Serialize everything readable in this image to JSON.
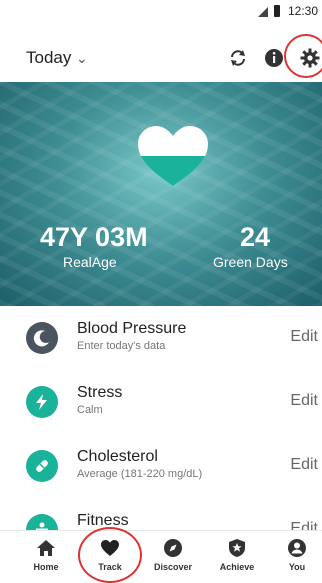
{
  "status": {
    "time": "12:30"
  },
  "header": {
    "title": "Today"
  },
  "hero": {
    "age_value": "47Y 03M",
    "age_label": "RealAge",
    "green_value": "24",
    "green_label": "Green Days"
  },
  "metrics": [
    {
      "name": "Blood Pressure",
      "subtitle": "Enter today's data",
      "action": "Edit",
      "icon": "moon-icon",
      "color": "#4a5560"
    },
    {
      "name": "Stress",
      "subtitle": "Calm",
      "action": "Edit",
      "icon": "lightning-icon",
      "color": "#1bb29a"
    },
    {
      "name": "Cholesterol",
      "subtitle": "Average (181-220 mg/dL)",
      "action": "Edit",
      "icon": "pill-icon",
      "color": "#1bb29a"
    },
    {
      "name": "Fitness",
      "subtitle": "",
      "action": "Edit",
      "icon": "person-icon",
      "color": "#1bb29a"
    }
  ],
  "tabs": [
    {
      "label": "Home",
      "icon": "home-icon"
    },
    {
      "label": "Track",
      "icon": "heart-icon"
    },
    {
      "label": "Discover",
      "icon": "compass-icon"
    },
    {
      "label": "Achieve",
      "icon": "shield-star-icon"
    },
    {
      "label": "You",
      "icon": "user-icon"
    }
  ],
  "colors": {
    "accent": "#1bb29a",
    "highlight_ring": "#dd3333"
  }
}
